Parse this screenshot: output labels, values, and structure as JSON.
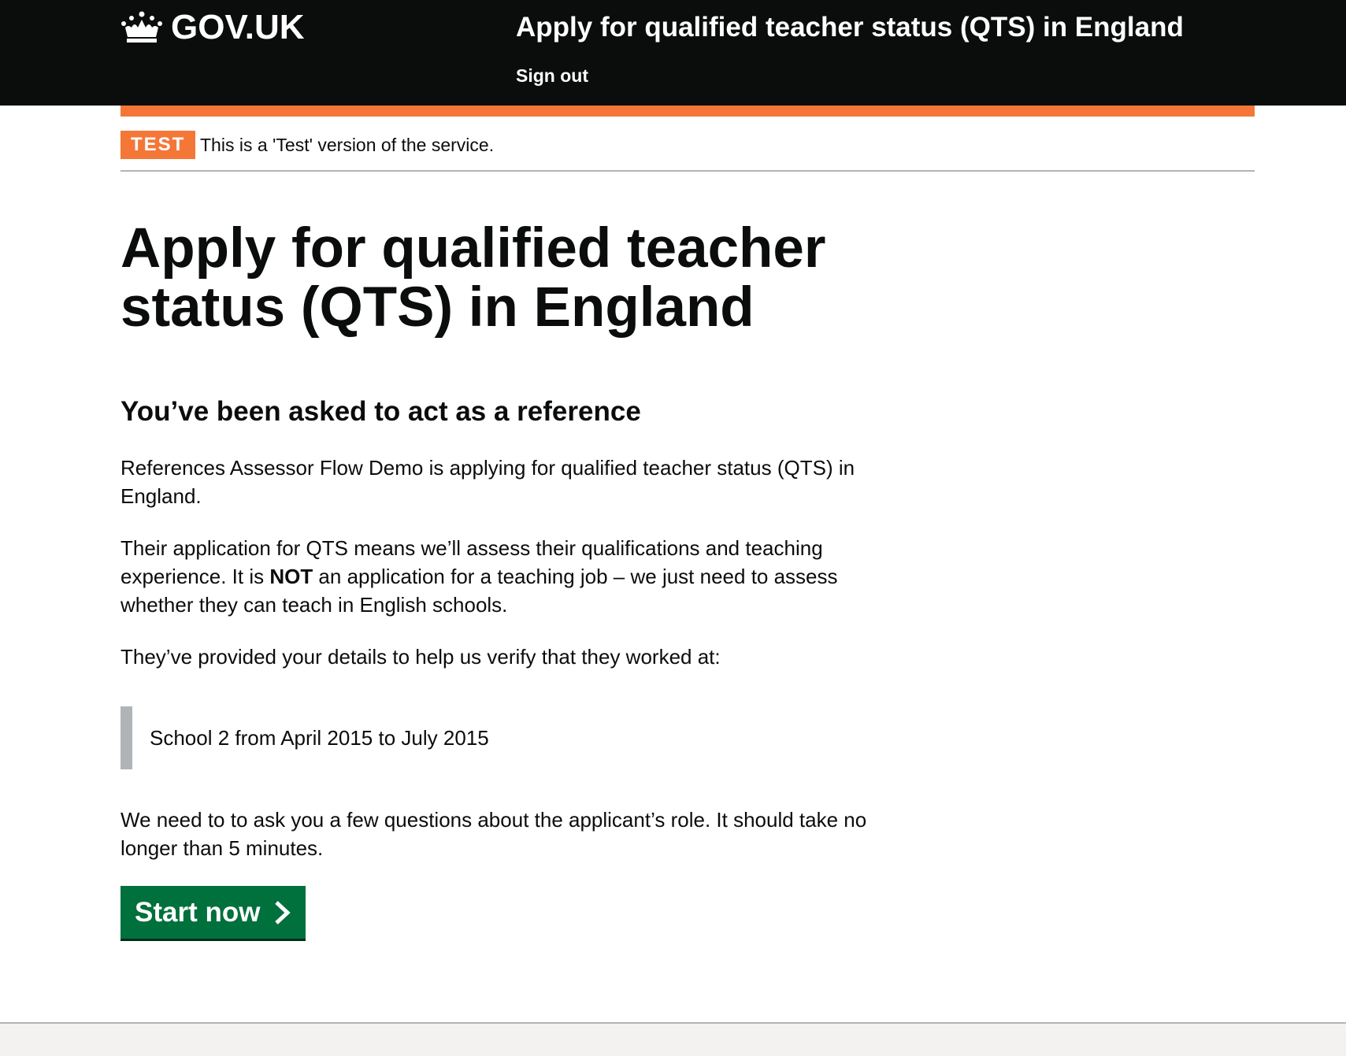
{
  "header": {
    "logo_text": "GOV.UK",
    "logo_icon": "crown-icon",
    "service_name": "Apply for qualified teacher status (QTS) in England",
    "sign_out": "Sign out"
  },
  "phase_banner": {
    "tag": "TEST",
    "text": "This is a 'Test' version of the service."
  },
  "main": {
    "title": "Apply for qualified teacher status (QTS) in England",
    "subheading": "You’ve been asked to act as a reference",
    "paragraph_1": "References Assessor Flow Demo is applying for qualified teacher status (QTS) in England.",
    "paragraph_2_before": "Their application for QTS means we’ll assess their qualifications and teaching experience. It is ",
    "paragraph_2_bold": "NOT",
    "paragraph_2_after": " an application for a teaching job – we just need to assess whether they can teach in English schools.",
    "paragraph_3": "They’ve provided your details to help us verify that they worked at:",
    "inset": "School 2 from April 2015 to July 2015",
    "paragraph_4": "We need to to ask you a few questions about the applicant’s role. It should take no longer than 5 minutes.",
    "start_button": "Start now",
    "start_button_icon": "chevron-right-icon"
  },
  "colors": {
    "header_bg": "#0b0c0c",
    "phase_orange": "#f47738",
    "button_green": "#00703c",
    "inset_border": "#b1b4b6",
    "footer_bg": "#f3f2f1"
  }
}
